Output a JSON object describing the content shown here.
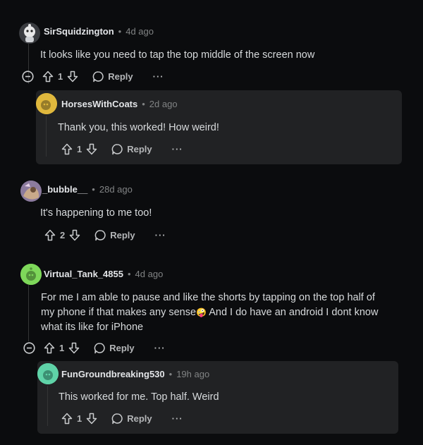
{
  "colors": {
    "background": "#0b0c0e",
    "card": "#212224",
    "text": "#d7dadc",
    "muted": "#818384"
  },
  "comments": [
    {
      "author": "SirSquidzington",
      "time": "4d ago",
      "body": "It looks like you need to tap the top middle of the screen now",
      "votes": "1",
      "reply_label": "Reply",
      "more": "···",
      "replies": [
        {
          "author": "HorsesWithCoats",
          "time": "2d ago",
          "body": "Thank you, this worked! How weird!",
          "votes": "1",
          "reply_label": "Reply",
          "more": "···"
        }
      ]
    },
    {
      "author": "_bubble__",
      "time": "28d ago",
      "body": "It's happening to me too!",
      "votes": "2",
      "reply_label": "Reply",
      "more": "···"
    },
    {
      "author": "Virtual_Tank_4855",
      "time": "4d ago",
      "body_line1": "For me I am able to pause and like the shorts by tapping on the top half of",
      "body_line2": "my phone if that makes any sense",
      "body_emoji": "🤪",
      "body_line2b": " And I do have an android I dont know",
      "body_line3": "what its like for iPhone",
      "votes": "1",
      "reply_label": "Reply",
      "more": "···",
      "replies": [
        {
          "author": "FunGroundbreaking530",
          "time": "19h ago",
          "body": "This worked for me. Top half. Weird",
          "votes": "1",
          "reply_label": "Reply",
          "more": "···"
        }
      ]
    }
  ],
  "separator": "•"
}
